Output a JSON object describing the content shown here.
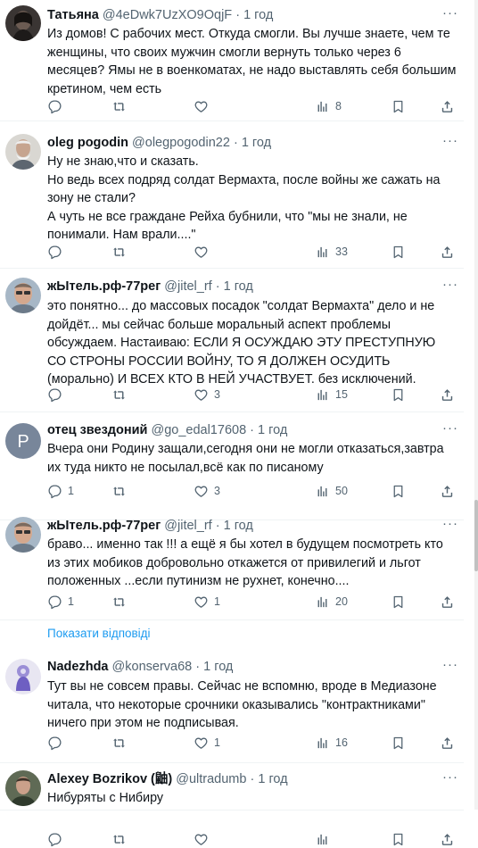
{
  "tweets": [
    {
      "name": "Татьяна",
      "handle": "@4eDwk7UzXO9OqjF",
      "time": "1 год",
      "text": "Из домов! С рабочих мест. Откуда смогли. Вы лучше знаете, чем те женщины, что своих мужчин смогли вернуть только через 6 месяцев? Ямы не в военкоматах, не надо выставлять себя большим кретином, чем есть",
      "replies": "",
      "retweets": "",
      "likes": "",
      "views": "8"
    },
    {
      "name": "oleg pogodin",
      "handle": "@olegpogodin22",
      "time": "1 год",
      "text": "Ну не знаю,что и сказать.\nНо ведь всех подряд солдат Вермахта, после войны же сажать на зону не стали?\nА чуть не все граждане Рейха бубнили, что \"мы не знали, не понимали. Нам врали....\"",
      "replies": "",
      "retweets": "",
      "likes": "",
      "views": "33"
    },
    {
      "name": "жЫтель.рф-77рег",
      "handle": "@jitel_rf",
      "time": "1 год",
      "text": "это понятно... до массовых посадок \"солдат Вермахта\" дело и не дойдёт... мы сейчас больше моральный аспект проблемы обсуждаем. Настаиваю: ЕСЛИ Я ОСУЖДАЮ ЭТУ ПРЕСТУПНУЮ СО СТРОНЫ РОССИИ ВОЙНУ, ТО Я ДОЛЖЕН ОСУДИТЬ (морально) И ВСЕХ КТО В НЕЙ УЧАСТВУЕТ. без исключений.",
      "replies": "",
      "retweets": "",
      "likes": "3",
      "views": "15"
    },
    {
      "name": "отец звездоний",
      "handle": "@go_edal17608",
      "time": "1 год",
      "avatar_letter": "P",
      "text": "Вчера они Родину защали,сегодня они не могли отказаться,завтра их туда никто не посылал,всё как по писаному",
      "replies": "1",
      "retweets": "",
      "likes": "3",
      "views": "50"
    },
    {
      "name": "жЫтель.рф-77рег",
      "handle": "@jitel_rf",
      "time": "1 год",
      "text": "браво... именно так !!! а ещё я бы хотел в будущем посмотреть кто из этих мобиков добровольно откажется от привилегий и льгот положенных ...если путинизм не рухнет, конечно....",
      "replies": "1",
      "retweets": "",
      "likes": "1",
      "views": "20"
    },
    {
      "name": "Nadezhda",
      "handle": "@konserva68",
      "time": "1 год",
      "text": "Тут вы не совсем правы. Сейчас не вспомню, вроде в Медиазоне читала, что некоторые срочники оказывались \"контрактниками\" ничего при этом не подписывая.",
      "replies": "",
      "retweets": "",
      "likes": "1",
      "views": "16"
    },
    {
      "name": "Alexey Bozrikov (鼬)",
      "handle": "@ultradumb",
      "time": "1 год",
      "text": "Нибуряты с Нибиру",
      "replies": "",
      "retweets": "",
      "likes": "",
      "views": ""
    }
  ],
  "show_replies": "Показати відповіді",
  "separator": "·",
  "more_glyph": "···",
  "colors": {
    "accent": "#1d9bf0",
    "muted": "#536471",
    "text": "#0f1419",
    "avatar_p": "#78869a"
  },
  "icons": [
    "reply-icon",
    "retweet-icon",
    "like-icon",
    "views-icon",
    "bookmark-icon",
    "share-icon",
    "more-icon"
  ]
}
